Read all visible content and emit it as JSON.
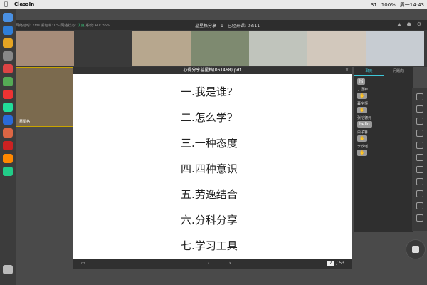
{
  "menubar": {
    "app_name": "ClassIn",
    "wechat_count": "31",
    "battery": "100%",
    "clock": "周一14:43"
  },
  "topbar": {
    "network_delay": "网络延时: 7ms",
    "loss_rate": "丢包率: 0%",
    "network_status_label": "网络状态:",
    "network_status": "优良",
    "cpu": "系统CPU: 35%",
    "class_title": "墓星格分享 - 1",
    "timer": "已经开课: 03:11"
  },
  "video": {
    "tiles": [
      {
        "name": ""
      },
      {
        "name": ""
      },
      {
        "name": ""
      },
      {
        "name": ""
      },
      {
        "name": ""
      },
      {
        "name": ""
      }
    ],
    "self_name": "墓星格"
  },
  "document": {
    "title": "心得分享墓星格(061468).pdf",
    "lines": [
      "一.我是谁?",
      "二.怎么学?",
      "三.一种态度",
      "四.四种意识",
      "五.劳逸结合",
      "六.分科分享",
      "七.学习工具"
    ],
    "page_current": "2",
    "page_total": "/ 53"
  },
  "chat": {
    "tab_chat": "聊天",
    "tab_qa": "问题向",
    "messages": [
      {
        "name": "",
        "text": "hi"
      },
      {
        "name": "丁嘉锦",
        "text": ""
      },
      {
        "name": "暮宇恒",
        "text": ""
      },
      {
        "name": "张韬德元",
        "text": "hello"
      },
      {
        "name": "白子鲁",
        "text": ""
      },
      {
        "name": "李欣瑶",
        "text": ""
      }
    ]
  },
  "hand_label": "举手"
}
